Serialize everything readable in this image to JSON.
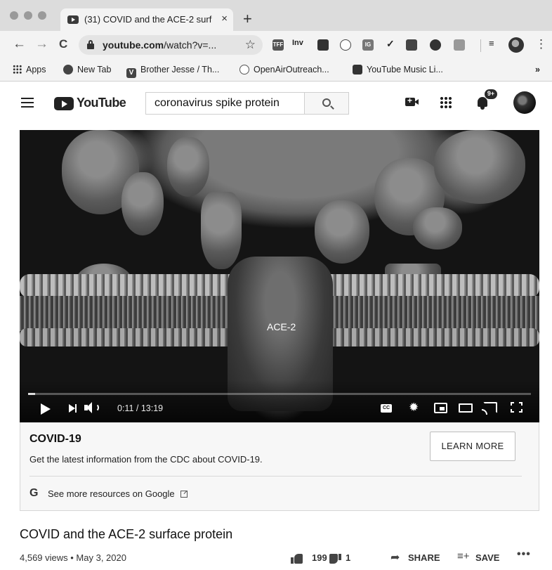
{
  "browser": {
    "tab_title": "(31) COVID and the ACE-2 surf",
    "tab_close": "×",
    "new_tab": "+",
    "url_host": "youtube.com",
    "url_path": "/watch?v=...",
    "extensions": [
      "TFF",
      "Inv",
      "IG"
    ],
    "bookmarks": {
      "apps": "Apps",
      "new_tab": "New Tab",
      "brother_jesse": "Brother Jesse / Th...",
      "openair": "OpenAirOutreach...",
      "yt_music": "YouTube Music Li...",
      "overflow": "»"
    }
  },
  "masthead": {
    "logo_text": "YouTube",
    "search_value": "coronavirus spike protein",
    "notification_badge": "9+"
  },
  "player": {
    "overlay_label": "ACE-2",
    "current_time": "0:11",
    "duration": "13:19",
    "time_display": "0:11 / 13:19",
    "progress_fraction": 0.0138,
    "cc_label": "CC"
  },
  "info_panel": {
    "title": "COVID-19",
    "description": "Get the latest information from the CDC about COVID-19.",
    "learn_more": "LEARN MORE",
    "google_g": "G",
    "more_resources": "See more resources on Google"
  },
  "video": {
    "title": "COVID and the ACE-2 surface protein",
    "views_date": "4,569 views • May 3, 2020",
    "likes": "199",
    "dislikes": "1",
    "share": "SHARE",
    "save": "SAVE",
    "more": "•••"
  },
  "icons": {
    "back": "←",
    "forward": "→",
    "reload": "C",
    "star": "☆",
    "check": "✓",
    "kebab": "⋮",
    "gear": "✹",
    "share": "➦",
    "save": "≡+"
  }
}
